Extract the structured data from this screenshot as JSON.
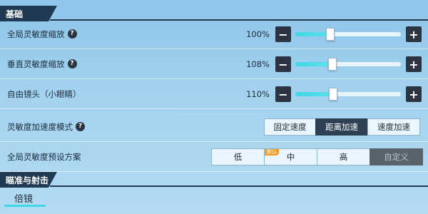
{
  "sections": {
    "basic": "基础",
    "aim": "瞄准与射击"
  },
  "rows": {
    "global": {
      "label": "全局灵敏度缩放",
      "value": "100%",
      "level": 0.33
    },
    "vertical": {
      "label": "垂直灵敏度缩放",
      "value": "108%",
      "level": 0.35
    },
    "freelook": {
      "label": "自由镜头（小眼睛）",
      "value": "110%",
      "level": 0.36
    },
    "accel": {
      "label": "灵敏度加速度模式",
      "options": [
        "固定速度",
        "距离加速",
        "速度加速"
      ],
      "selected": 1
    },
    "preset": {
      "label": "全局灵敏度预设方案",
      "options": [
        "低",
        "中",
        "高",
        "自定义"
      ],
      "badge": "默认",
      "selected": 3
    }
  },
  "icons": {
    "help": "question-circle-icon",
    "minus": "minus-icon",
    "plus": "plus-icon"
  },
  "glyphs": {
    "help": "?",
    "minus": "−",
    "plus": "+"
  },
  "tabs": {
    "scope": "倍镜"
  },
  "colors": {
    "accent": "#3fd6e6",
    "dark": "#2b3440",
    "header": "#1f3a52"
  }
}
